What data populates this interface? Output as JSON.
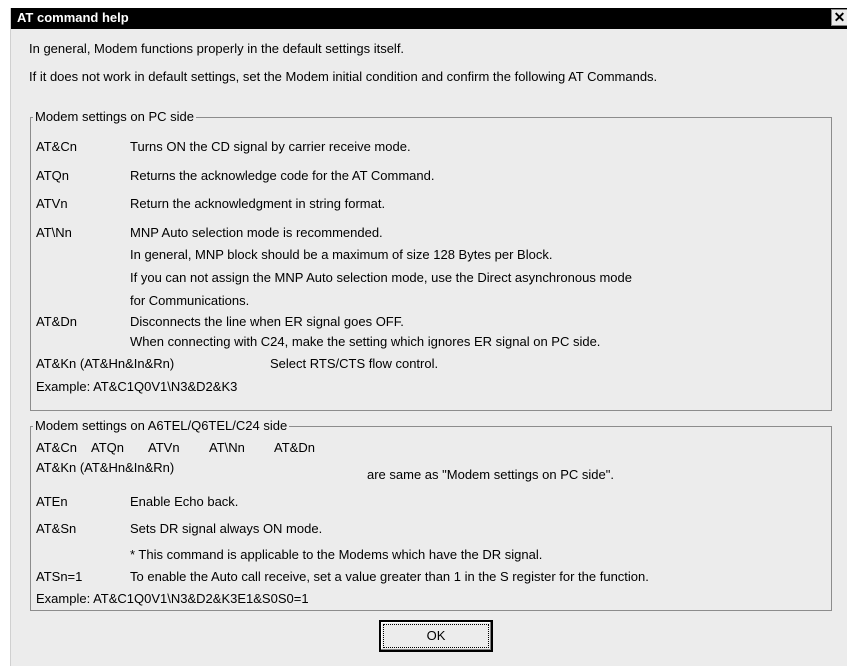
{
  "window": {
    "title": "AT command help",
    "close_glyph": "✕"
  },
  "intro": {
    "line1": "In general, Modem functions properly in the default settings itself.",
    "line2": "If it does not work in default settings, set the Modem initial condition and confirm the following AT Commands."
  },
  "pc_group": {
    "legend": "Modem settings on PC side",
    "rows": [
      {
        "cmd": "AT&Cn",
        "desc": "Turns ON the CD signal by carrier receive mode."
      },
      {
        "cmd": "ATQn",
        "desc": "Returns the acknowledge code for the AT Command."
      },
      {
        "cmd": "ATVn",
        "desc": "Return the acknowledgment in string format."
      },
      {
        "cmd": "AT\\Nn",
        "desc": "MNP Auto selection mode is recommended."
      },
      {
        "cmd": "",
        "desc": "In general, MNP block should be a maximum of size 128 Bytes per Block."
      },
      {
        "cmd": "",
        "desc": "If you can not assign the MNP Auto selection mode, use the Direct asynchronous mode"
      },
      {
        "cmd": "",
        "desc": "for Communications."
      },
      {
        "cmd": "AT&Dn",
        "desc": "Disconnects the line when ER signal goes OFF."
      },
      {
        "cmd": "",
        "desc": "When connecting with C24, make the setting which ignores ER signal on PC side."
      }
    ],
    "kn_cmd": "AT&Kn (AT&Hn&In&Rn)",
    "kn_desc": "Select RTS/CTS flow control.",
    "example": "Example: AT&C1Q0V1\\N3&D2&K3"
  },
  "c24_group": {
    "legend": "Modem settings on A6TEL/Q6TEL/C24 side",
    "cmds": [
      "AT&Cn",
      "ATQn",
      "ATVn",
      "AT\\Nn",
      "AT&Dn"
    ],
    "kn_cmd": "AT&Kn (AT&Hn&In&Rn)",
    "same_note": "are same as \"Modem settings on PC side\".",
    "rows": [
      {
        "cmd": "ATEn",
        "desc": "Enable Echo back."
      },
      {
        "cmd": "AT&Sn",
        "desc": "Sets DR signal always ON mode."
      },
      {
        "cmd": "",
        "desc": "* This command is applicable to the Modems which have the DR signal."
      },
      {
        "cmd": "ATSn=1",
        "desc": "To enable the Auto call receive, set a value greater than 1 in the S register for the function."
      }
    ],
    "example": "Example: AT&C1Q0V1\\N3&D2&K3E1&S0S0=1"
  },
  "buttons": {
    "ok": "OK"
  }
}
